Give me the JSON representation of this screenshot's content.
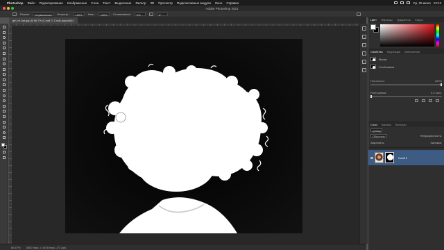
{
  "menubar": {
    "app": "Photoshop",
    "items": [
      "Файл",
      "Редактирование",
      "Изображение",
      "Слои",
      "Текст",
      "Выделение",
      "Фильтр",
      "3D",
      "Просмотр",
      "Подключаемые модули",
      "Окно",
      "Справка"
    ],
    "datetime": "Ср, 25 июня",
    "time": "13:13"
  },
  "titlebar": {
    "title": "Adobe Photoshop 2021"
  },
  "options": {
    "mode_label": "Режим:",
    "mode_value": "Нормальный",
    "opacity_label": "Непрозр.:",
    "opacity_value": "100%",
    "flow_label": "Наж.:",
    "flow_value": "100%",
    "smooth_label": "Сглаживание:",
    "smooth_value": "0%",
    "angle_value": "0°"
  },
  "document": {
    "tab_label": "girl-cfr-hat.jpg @ 66,7% (Слой 0, Слой-маска/8) *"
  },
  "statusbar": {
    "zoom": "66,67%",
    "info": "3000 пикс. x 1878 пикс. (72 ppi)"
  },
  "color_panel": {
    "tabs": [
      "Цвет",
      "Образцы",
      "Градиенты",
      "Узоры"
    ]
  },
  "properties_panel": {
    "tabs": [
      "Свойства",
      "Коррекция",
      "Библиотеки"
    ],
    "mask_label": "Маски",
    "layer_mask_label": "Слой-маска",
    "density_label": "Плотность:",
    "density_value": "100%",
    "feather_label": "Растушевка:",
    "feather_value": "0,0 пикс."
  },
  "layers_panel": {
    "tabs": [
      "Слои",
      "Каналы",
      "Контуры"
    ],
    "filter_label": "Q Вид",
    "blend_mode": "Обычные",
    "opacity_label": "Непрозрачность:",
    "lock_label": "Закрепить:",
    "fill_label": "Заливка:",
    "layers": [
      {
        "name": "Слой 0",
        "selected": true
      }
    ]
  },
  "colors": {
    "accent": "#3d5b83",
    "fg": "#ffffff",
    "bg": "#000000"
  }
}
